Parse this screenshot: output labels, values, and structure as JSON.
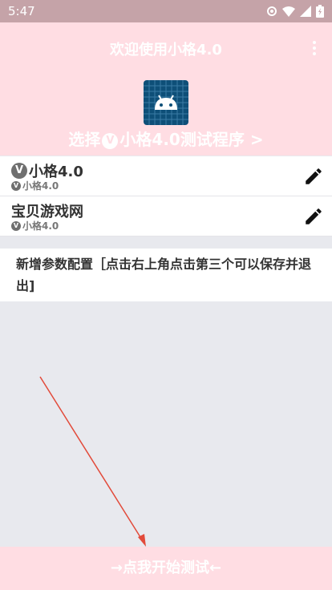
{
  "status": {
    "time": "5:47"
  },
  "header": {
    "title": "欢迎使用小格4.0",
    "badge": "V",
    "subtitle_before": "选择",
    "subtitle_after": "小格4.0测试程序 >"
  },
  "list": [
    {
      "badge": "V",
      "title": "小格4.0",
      "sub": "小格4.0"
    },
    {
      "title": "宝贝游戏网",
      "badge": "V",
      "sub": "小格4.0"
    }
  ],
  "config": {
    "text": "新增参数配置［点击右上角点击第三个可以保存并退出]"
  },
  "start_button": {
    "label": "→点我开始测试←"
  },
  "colors": {
    "header_bg": "#ffdde3",
    "status_bg": "#c5a3a8",
    "arrow": "#e24a3a",
    "icon_bg": "#0e4f78"
  }
}
